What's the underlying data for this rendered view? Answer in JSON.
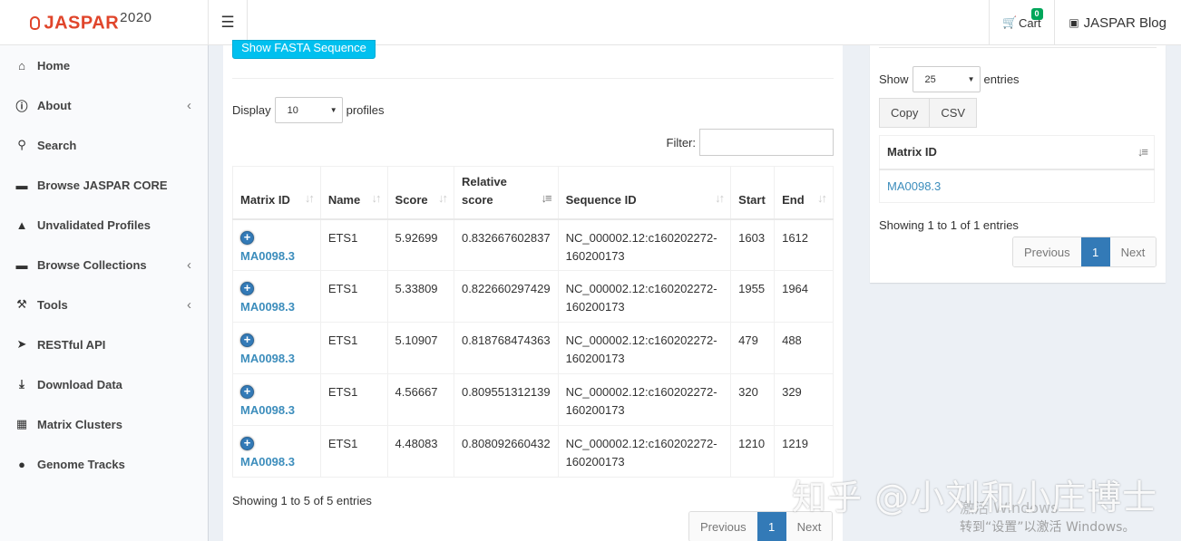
{
  "header": {
    "logo_text": "JASPAR",
    "logo_year": "2020",
    "menu_icon": "hamburger-icon",
    "cart_label": "Cart",
    "cart_count": "0",
    "blog_label": "JASPAR Blog"
  },
  "sidebar": {
    "items": [
      {
        "label": "Home",
        "icon": "home-icon",
        "chevron": false
      },
      {
        "label": "About",
        "icon": "info-circle-icon",
        "chevron": true
      },
      {
        "label": "Search",
        "icon": "search-icon",
        "chevron": false
      },
      {
        "label": "Browse JASPAR CORE",
        "icon": "folder-open-icon",
        "chevron": false
      },
      {
        "label": "Unvalidated Profiles",
        "icon": "warning-icon",
        "chevron": false
      },
      {
        "label": "Browse Collections",
        "icon": "folder-open-icon",
        "chevron": true
      },
      {
        "label": "Tools",
        "icon": "wrench-icon",
        "chevron": true
      },
      {
        "label": "RESTful API",
        "icon": "rocket-icon",
        "chevron": false
      },
      {
        "label": "Download Data",
        "icon": "download-icon",
        "chevron": false
      },
      {
        "label": "Matrix Clusters",
        "icon": "clusters-icon",
        "chevron": false
      },
      {
        "label": "Genome Tracks",
        "icon": "map-marker-icon",
        "chevron": false
      }
    ]
  },
  "main": {
    "fasta_button": "Show FASTA Sequence",
    "display_label": "Display",
    "display_value": "10",
    "profiles_label": "profiles",
    "filter_label": "Filter:",
    "filter_value": "",
    "columns": [
      "Matrix ID",
      "Name",
      "Score",
      "Relative score",
      "Sequence ID",
      "Start",
      "End"
    ],
    "rows": [
      {
        "matrix_id": "MA0098.3",
        "name": "ETS1",
        "score": "5.92699",
        "relative_score": "0.832667602837",
        "sequence_id_1": "NC_000002.12:c160202272-",
        "sequence_id_2": "160200173",
        "start": "1603",
        "end": "1612"
      },
      {
        "matrix_id": "MA0098.3",
        "name": "ETS1",
        "score": "5.33809",
        "relative_score": "0.822660297429",
        "sequence_id_1": "NC_000002.12:c160202272-",
        "sequence_id_2": "160200173",
        "start": "1955",
        "end": "1964"
      },
      {
        "matrix_id": "MA0098.3",
        "name": "ETS1",
        "score": "5.10907",
        "relative_score": "0.818768474363",
        "sequence_id_1": "NC_000002.12:c160202272-",
        "sequence_id_2": "160200173",
        "start": "479",
        "end": "488"
      },
      {
        "matrix_id": "MA0098.3",
        "name": "ETS1",
        "score": "4.56667",
        "relative_score": "0.809551312139",
        "sequence_id_1": "NC_000002.12:c160202272-",
        "sequence_id_2": "160200173",
        "start": "320",
        "end": "329"
      },
      {
        "matrix_id": "MA0098.3",
        "name": "ETS1",
        "score": "4.48083",
        "relative_score": "0.808092660432",
        "sequence_id_1": "NC_000002.12:c160202272-",
        "sequence_id_2": "160200173",
        "start": "1210",
        "end": "1219"
      }
    ],
    "info": "Showing 1 to 5 of 5 entries",
    "pager": {
      "previous": "Previous",
      "current": "1",
      "next": "Next"
    }
  },
  "cart_panel": {
    "show_label": "Show",
    "show_value": "25",
    "entries_label": "entries",
    "copy_button": "Copy",
    "csv_button": "CSV",
    "column": "Matrix ID",
    "rows": [
      "MA0098.3"
    ],
    "info": "Showing 1 to 1 of 1 entries",
    "pager": {
      "previous": "Previous",
      "current": "1",
      "next": "Next"
    }
  },
  "watermark": {
    "zhihu": "知乎 @小刘和小庄博士",
    "activate_title": "激活 Windows",
    "activate_hint": "转到“设置”以激活 Windows。"
  },
  "colors": {
    "accent": "#3c8dbc",
    "button_info": "#00c0ef",
    "pager_active": "#337ab7",
    "logo": "#e0452b",
    "badge": "#00a65a"
  }
}
